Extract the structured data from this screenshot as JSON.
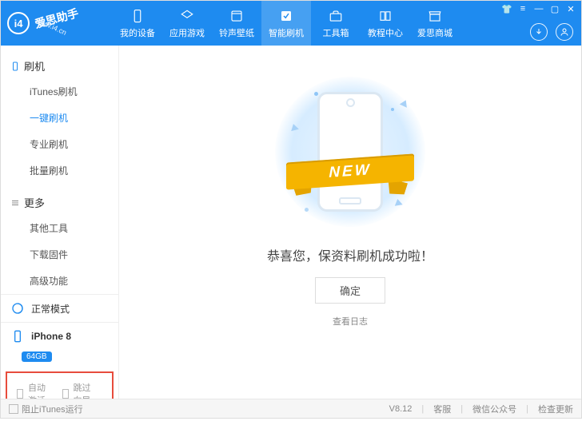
{
  "header": {
    "logo_text": "爱思助手",
    "logo_sub": "www.i4.cn",
    "tabs": [
      {
        "label": "我的设备"
      },
      {
        "label": "应用游戏"
      },
      {
        "label": "铃声壁纸"
      },
      {
        "label": "智能刷机"
      },
      {
        "label": "工具箱"
      },
      {
        "label": "教程中心"
      },
      {
        "label": "爱思商城"
      }
    ]
  },
  "sidebar": {
    "section1_title": "刷机",
    "section1_items": [
      "iTunes刷机",
      "一键刷机",
      "专业刷机",
      "批量刷机"
    ],
    "section2_title": "更多",
    "section2_items": [
      "其他工具",
      "下载固件",
      "高级功能"
    ],
    "mode_label": "正常模式",
    "device_name": "iPhone 8",
    "device_storage": "64GB",
    "chk_auto_activate": "自动激活",
    "chk_skip_guide": "跳过向导"
  },
  "main": {
    "ribbon_text": "NEW",
    "success_text": "恭喜您，保资料刷机成功啦！",
    "ok_button": "确定",
    "log_link": "查看日志"
  },
  "footer": {
    "block_itunes": "阻止iTunes运行",
    "version": "V8.12",
    "support": "客服",
    "wechat": "微信公众号",
    "update": "检查更新"
  }
}
